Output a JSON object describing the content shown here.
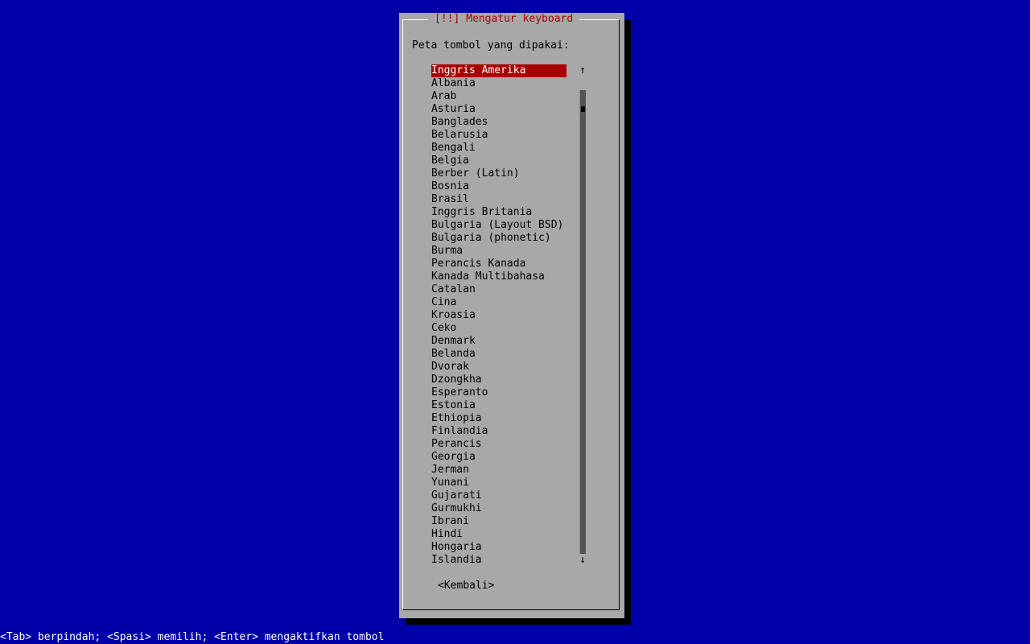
{
  "dialog": {
    "title": "[!!] Mengatur keyboard",
    "prompt": "Peta tombol yang dipakai:",
    "back_label": "<Kembali>"
  },
  "keymap_list": {
    "selected_index": 0,
    "items": [
      "Inggris Amerika",
      "Albania",
      "Arab",
      "Asturia",
      "Banglades",
      "Belarusia",
      "Bengali",
      "Belgia",
      "Berber (Latin)",
      "Bosnia",
      "Brasil",
      "Inggris Britania",
      "Bulgaria (Layout BSD)",
      "Bulgaria (phonetic)",
      "Burma",
      "Perancis Kanada",
      "Kanada Multibahasa",
      "Catalan",
      "Cina",
      "Kroasia",
      "Ceko",
      "Denmark",
      "Belanda",
      "Dvorak",
      "Dzongkha",
      "Esperanto",
      "Estonia",
      "Ethiopia",
      "Finlandia",
      "Perancis",
      "Georgia",
      "Jerman",
      "Yunani",
      "Gujarati",
      "Gurmukhi",
      "Ibrani",
      "Hindi",
      "Hongaria",
      "Islandia"
    ]
  },
  "scrollbar": {
    "up_glyph": "↑",
    "down_glyph": "↓"
  },
  "status_bar": {
    "text": "<Tab> berpindah; <Spasi> memilih; <Enter> mengaktifkan tombol"
  },
  "colors": {
    "background": "#0000a8",
    "dialog": "#a8a8a8",
    "title": "#a80000",
    "selection": "#a80000"
  }
}
